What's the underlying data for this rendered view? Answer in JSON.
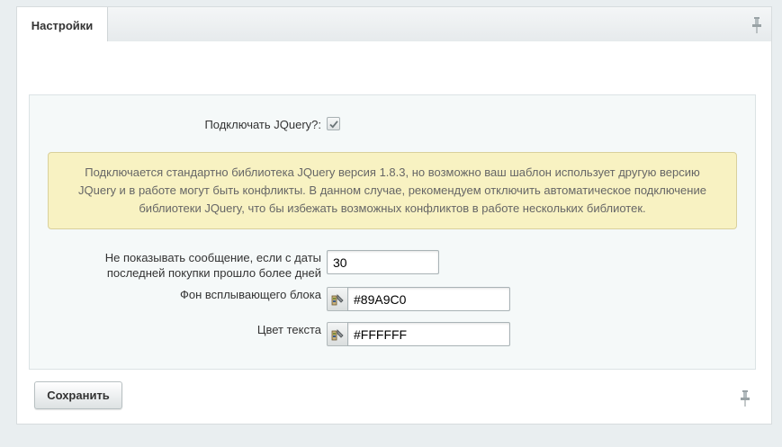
{
  "tabs": [
    {
      "label": "Настройки",
      "active": true
    }
  ],
  "jquery": {
    "label": "Подключать JQuery?:",
    "checked": true
  },
  "notice": {
    "lines": [
      "Подключается стандартно библиотека JQuery версия 1.8.3, но возможно ваш шаблон использует другую версию",
      "JQuery и в работе могут быть конфликты. В данном случае, рекомендуем отключить автоматическое подключение",
      "библиотеки JQuery, что бы избежать возможных конфликтов в работе нескольких библиотек."
    ]
  },
  "fields": {
    "days": {
      "label_lines": [
        "Не показывать сообщение, если с даты",
        "последней покупки прошло более дней"
      ],
      "value": "30"
    },
    "bg_color": {
      "label": "Фон всплывающего блока",
      "value": "#89A9C0"
    },
    "text_color": {
      "label": "Цвет текста",
      "value": "#FFFFFF"
    }
  },
  "buttons": {
    "save_label": "Сохранить"
  },
  "icons": {
    "pin": "pin-icon",
    "color_picker": "color-picker-icon",
    "checkmark": "checkmark-icon"
  },
  "colors": {
    "notice_bg": "#f8f2c2",
    "panel_bg": "#ffffff",
    "box_bg": "#f5f9f9"
  }
}
